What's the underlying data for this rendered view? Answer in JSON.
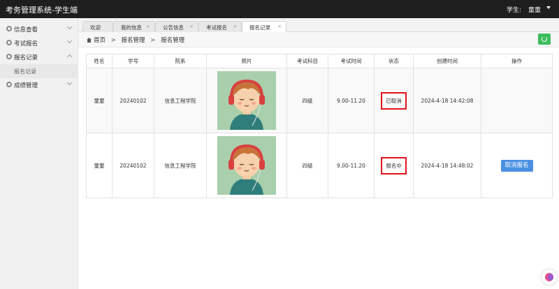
{
  "header": {
    "title": "考务管理系统-学生端",
    "user_label": "学生:",
    "user_name": "童童"
  },
  "sidebar": {
    "items": [
      {
        "label": "信息查看",
        "expanded": false
      },
      {
        "label": "考试报名",
        "expanded": false
      },
      {
        "label": "报名记录",
        "expanded": true
      },
      {
        "label": "成绩管理",
        "expanded": false
      }
    ],
    "subitem": "报名记录"
  },
  "tabs": [
    {
      "label": "欢迎",
      "close": ""
    },
    {
      "label": "我的信息",
      "close": "×"
    },
    {
      "label": "公告信息",
      "close": "×"
    },
    {
      "label": "考试报名",
      "close": "×"
    },
    {
      "label": "报名记录",
      "close": "×"
    }
  ],
  "breadcrumb": {
    "home": "首页",
    "sep": ">",
    "level1": "报名管理",
    "level2": "报名管理"
  },
  "table": {
    "headers": [
      "姓名",
      "学号",
      "院系",
      "照片",
      "考试科目",
      "考试时间",
      "状态",
      "创建时间",
      "操作"
    ],
    "rows": [
      {
        "name": "童童",
        "id": "20240102",
        "dept": "信息工程学院",
        "subject": "四级",
        "time": "9.00-11.20",
        "status": "已取消",
        "created": "2024-4-18 14:42:08",
        "action": ""
      },
      {
        "name": "童童",
        "id": "20240102",
        "dept": "信息工程学院",
        "subject": "四级",
        "time": "9.00-11.20",
        "status": "报名中",
        "created": "2024-4-18 14:48:02",
        "action": "取消报名"
      }
    ]
  },
  "colors": {
    "topbar": "#1e1e1e",
    "refresh": "#3dbd5d",
    "highlight": "#e0131a",
    "primary_button": "#4a90e2"
  }
}
